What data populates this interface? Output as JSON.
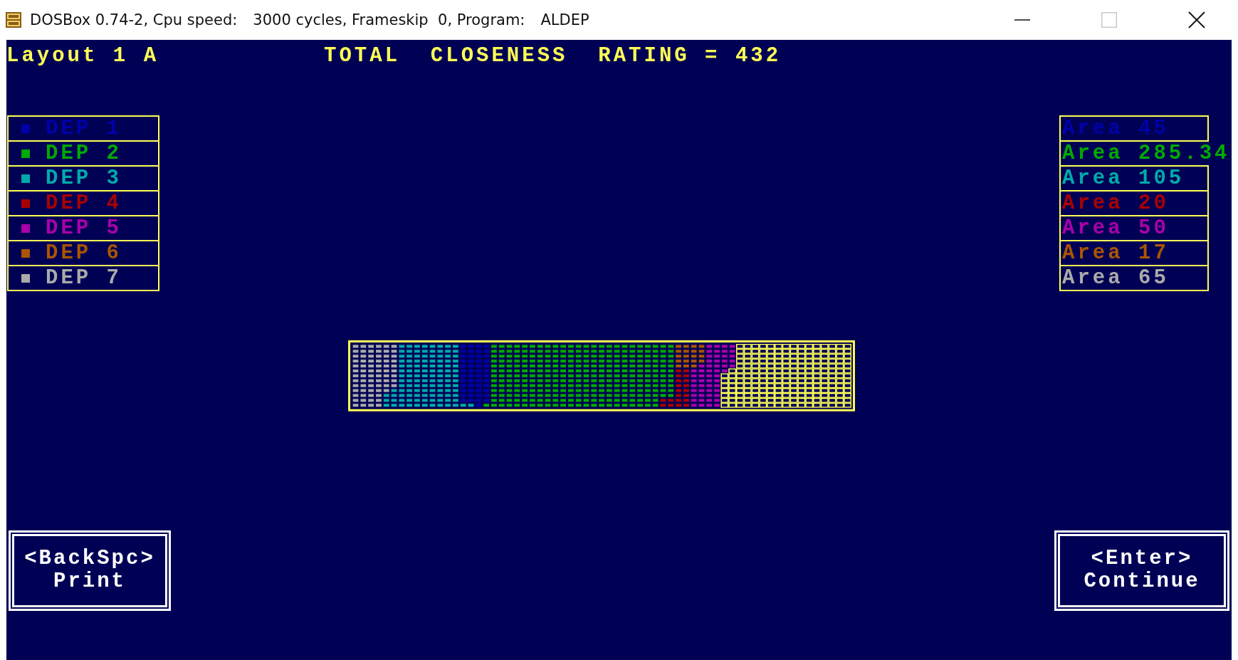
{
  "window": {
    "title_parts": [
      "DOSBox 0.74-2, Cpu speed:",
      "3000 cycles, Frameskip  0, Program:",
      "ALDEP"
    ],
    "maximize_disabled": true
  },
  "header": {
    "layout": "Layout 1 A",
    "rating": "TOTAL  CLOSENESS  RATING = 432"
  },
  "departments": [
    {
      "label": "DEP 1",
      "color": "#0000aa"
    },
    {
      "label": "DEP 2",
      "color": "#00aa00"
    },
    {
      "label": "DEP 3",
      "color": "#00aaaa"
    },
    {
      "label": "DEP 4",
      "color": "#aa0000"
    },
    {
      "label": "DEP 5",
      "color": "#aa00aa"
    },
    {
      "label": "DEP 6",
      "color": "#aa5500"
    },
    {
      "label": "DEP 7",
      "color": "#aaaaaa"
    }
  ],
  "areas": [
    {
      "text": "Area 45"
    },
    {
      "text": "Area 285.34"
    },
    {
      "text": "Area 105"
    },
    {
      "text": "Area 20"
    },
    {
      "text": "Area 50"
    },
    {
      "text": "Area 17"
    },
    {
      "text": "Area 65"
    }
  ],
  "buttons": [
    {
      "key": "<BackSpc>",
      "action": "Print"
    },
    {
      "key": "<Enter>",
      "action": "Continue"
    }
  ]
}
